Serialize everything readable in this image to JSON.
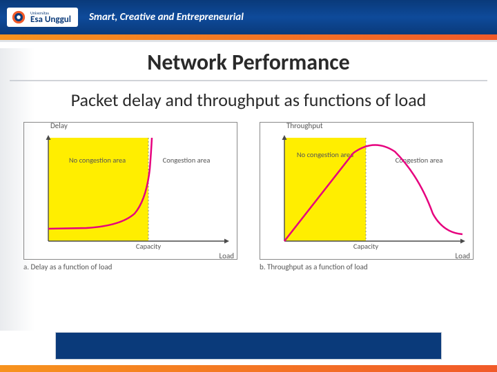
{
  "header": {
    "university_small": "Universitas",
    "university_name": "Esa Unggul",
    "tagline": "Smart, Creative and Entrepreneurial"
  },
  "title": "Network Performance",
  "subtitle": "Packet delay and throughput as functions of load",
  "charts": {
    "a": {
      "ylabel": "Delay",
      "xlabel": "Load",
      "capacity_label": "Capacity",
      "no_congestion": "No congestion area",
      "congestion": "Congestion area",
      "caption": "a. Delay as a function of load"
    },
    "b": {
      "ylabel": "Throughput",
      "xlabel": "Load",
      "capacity_label": "Capacity",
      "no_congestion": "No congestion area",
      "congestion": "Congestion area",
      "caption": "b. Throughput as a function of load"
    }
  },
  "chart_data": [
    {
      "type": "line",
      "title": "Delay as a function of load",
      "xlabel": "Load",
      "ylabel": "Delay",
      "xlim": [
        0,
        1.6
      ],
      "ylim": [
        0,
        1
      ],
      "capacity_x": 0.9,
      "regions": [
        {
          "name": "No congestion area",
          "x_range": [
            0,
            0.9
          ]
        },
        {
          "name": "Congestion area",
          "x_range": [
            0.9,
            1.6
          ]
        }
      ],
      "series": [
        {
          "name": "Delay",
          "x": [
            0,
            0.3,
            0.5,
            0.7,
            0.8,
            0.85,
            0.88,
            0.9,
            0.92,
            0.95
          ],
          "y": [
            0.12,
            0.13,
            0.15,
            0.2,
            0.32,
            0.5,
            0.7,
            0.85,
            0.95,
            1.0
          ]
        }
      ]
    },
    {
      "type": "line",
      "title": "Throughput as a function of load",
      "xlabel": "Load",
      "ylabel": "Throughput",
      "xlim": [
        0,
        1.6
      ],
      "ylim": [
        0,
        1
      ],
      "capacity_x": 0.75,
      "regions": [
        {
          "name": "No congestion area",
          "x_range": [
            0,
            0.75
          ]
        },
        {
          "name": "Congestion area",
          "x_range": [
            0.75,
            1.6
          ]
        }
      ],
      "series": [
        {
          "name": "Throughput",
          "x": [
            0,
            0.2,
            0.4,
            0.6,
            0.75,
            0.85,
            1.0,
            1.1,
            1.2,
            1.35,
            1.5,
            1.6
          ],
          "y": [
            0,
            0.25,
            0.5,
            0.75,
            0.9,
            0.95,
            0.85,
            0.7,
            0.5,
            0.3,
            0.2,
            0.18
          ]
        }
      ]
    }
  ]
}
